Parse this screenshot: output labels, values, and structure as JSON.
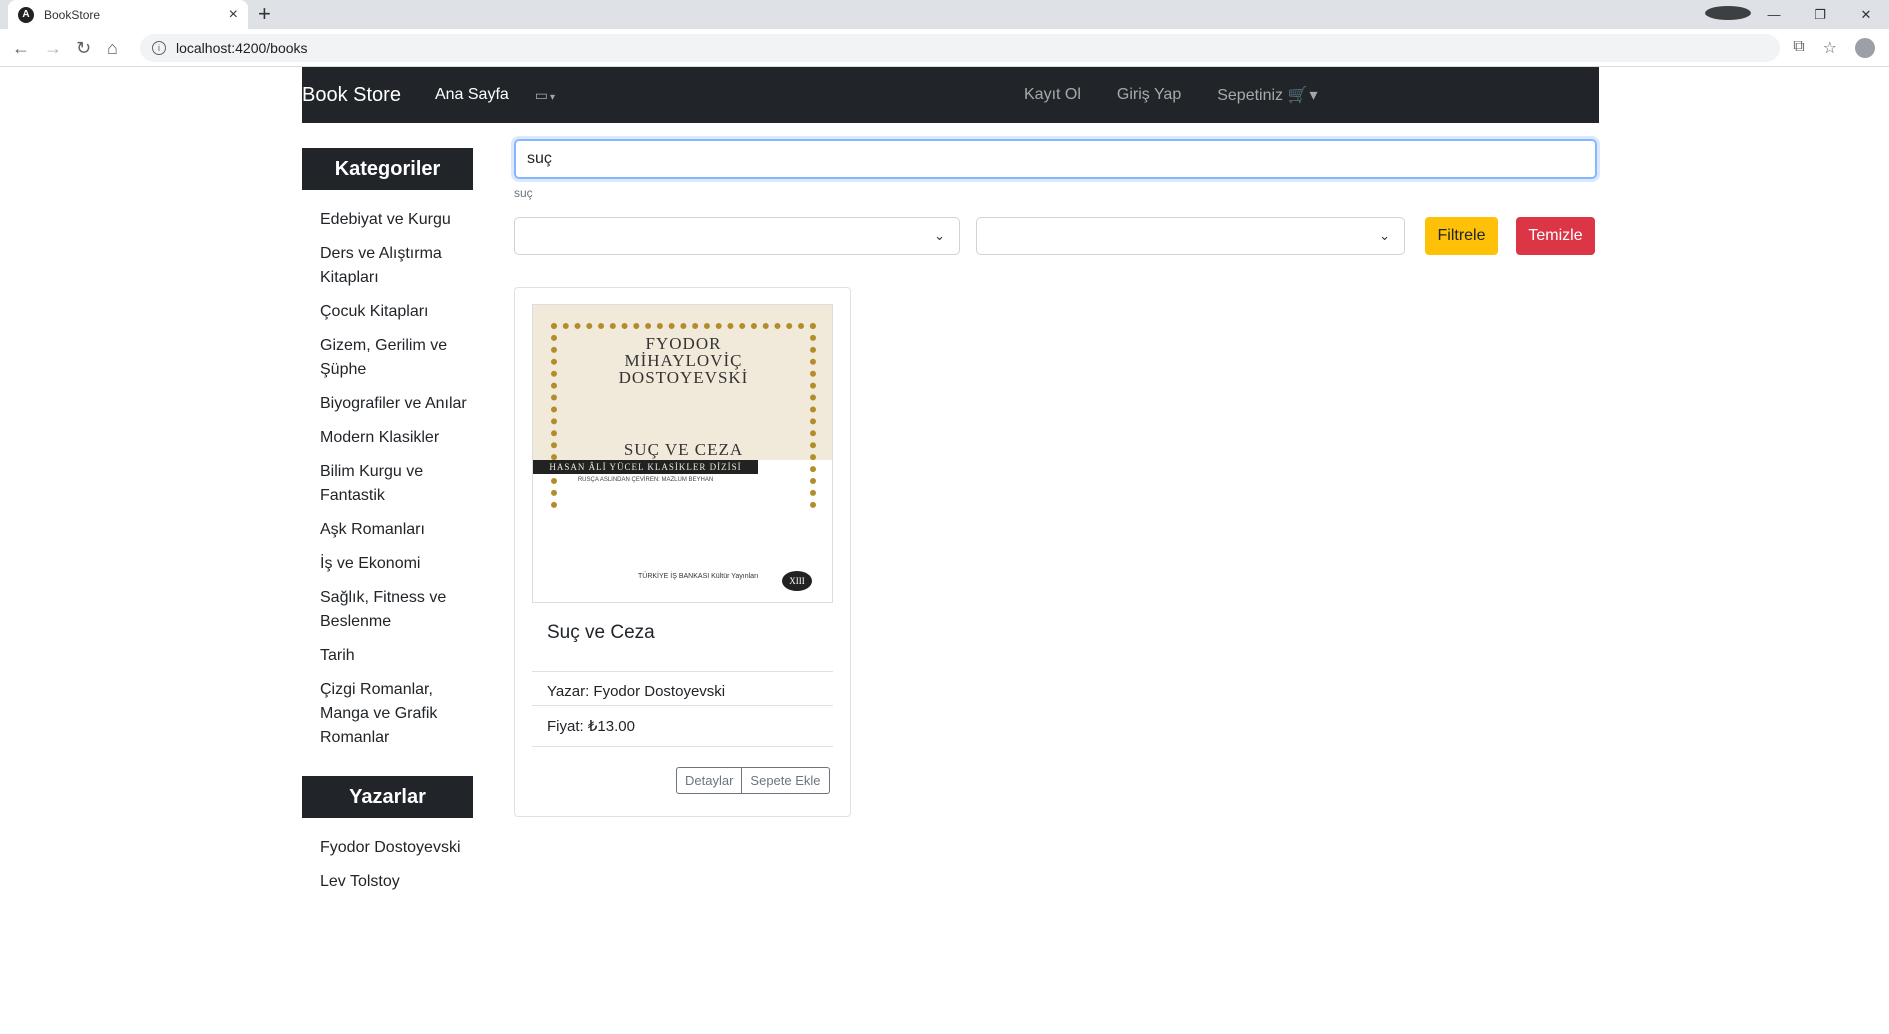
{
  "browser": {
    "tab_title": "BookStore",
    "tab_favicon": "A",
    "url": "localhost:4200/books"
  },
  "navbar": {
    "brand": "Book Store",
    "home": "Ana Sayfa",
    "register": "Kayıt Ol",
    "login": "Giriş Yap",
    "cart": "Sepetiniz"
  },
  "sidebar": {
    "categories_title": "Kategoriler",
    "categories": [
      "Edebiyat ve Kurgu",
      "Ders ve Alıştırma Kitapları",
      "Çocuk Kitapları",
      "Gizem, Gerilim ve Şüphe",
      "Biyografiler ve Anılar",
      "Modern Klasikler",
      "Bilim Kurgu ve Fantastik",
      "Aşk Romanları",
      "İş ve Ekonomi",
      "Sağlık, Fitness ve Beslenme",
      "Tarih",
      "Çizgi Romanlar, Manga ve Grafik Romanlar"
    ],
    "authors_title": "Yazarlar",
    "authors": [
      "Fyodor Dostoyevski",
      "Lev Tolstoy"
    ]
  },
  "search": {
    "value": "suç",
    "caption": "suç"
  },
  "filters": {
    "select1_value": "",
    "select2_value": "",
    "filter_button": "Filtrele",
    "clear_button": "Temizle",
    "filter_color": "#ffc107",
    "clear_color": "#dc3545"
  },
  "book": {
    "title": "Suç ve Ceza",
    "author_line": "Yazar: Fyodor Dostoyevski",
    "price_line": "Fiyat: ₺13.00",
    "details_button": "Detaylar",
    "add_to_cart_button": "Sepete Ekle",
    "cover": {
      "author_line1": "FYODOR",
      "author_line2": "MİHAYLOVİÇ",
      "author_line3": "DOSTOYEVSKİ",
      "title": "SUÇ VE CEZA",
      "series": "HASAN ÂLİ YÜCEL KLASİKLER DİZİSİ",
      "translator": "RUSÇA ASLINDAN ÇEVİREN: MAZLUM BEYHAN",
      "publisher": "TÜRKİYE İŞ BANKASI Kültür Yayınları",
      "badge": "XIII"
    }
  }
}
